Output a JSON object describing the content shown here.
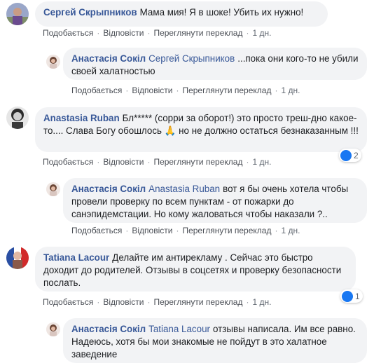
{
  "actions": {
    "like": "Подобається",
    "reply": "Відповісти",
    "translate": "Переглянути переклад",
    "time": "1 дн."
  },
  "comments": [
    {
      "author": "Сергей Скрыпников",
      "mention": "",
      "text": "Мама мия! Я в шоке! Убить их нужно!",
      "reactions": ""
    },
    {
      "author": "Анастасія Сокіл",
      "mention": "Сергей Скрыпников",
      "text": "...пока они кого-то не убили своей халатностью",
      "reactions": ""
    },
    {
      "author": "Anastasia Ruban",
      "mention": "",
      "text": "Бл***** (сорри за оборот!) это просто треш-дно какое-то.... Слава Богу обошлось 🙏 но не должно остаться безнаказанным !!!",
      "reactions": "2"
    },
    {
      "author": "Анастасія Сокіл",
      "mention": "Anastasia Ruban",
      "text": "вот я бы очень хотела чтобы провели проверку по всем пунктам - от пожарки до санэпидемстации. Но кому жаловаться чтобы наказали ?..",
      "reactions": ""
    },
    {
      "author": "Tatiana Lacour",
      "mention": "",
      "text": "Делайте им антирекламу . Сейчас это быстро доходит до родителей. Отзывы в соцсетях и проверку безопасности послать.",
      "reactions": "1"
    },
    {
      "author": "Анастасія Сокіл",
      "mention": "Tatiana Lacour",
      "text": "отзывы написала. Им все равно. Надеюсь, хотя бы мои знакомые не пойдут в это халатное заведение",
      "reactions": ""
    }
  ],
  "colors": {
    "author": "#385898",
    "bubble": "#f2f3f5",
    "like": "#1877f2",
    "meta": "#606770"
  }
}
